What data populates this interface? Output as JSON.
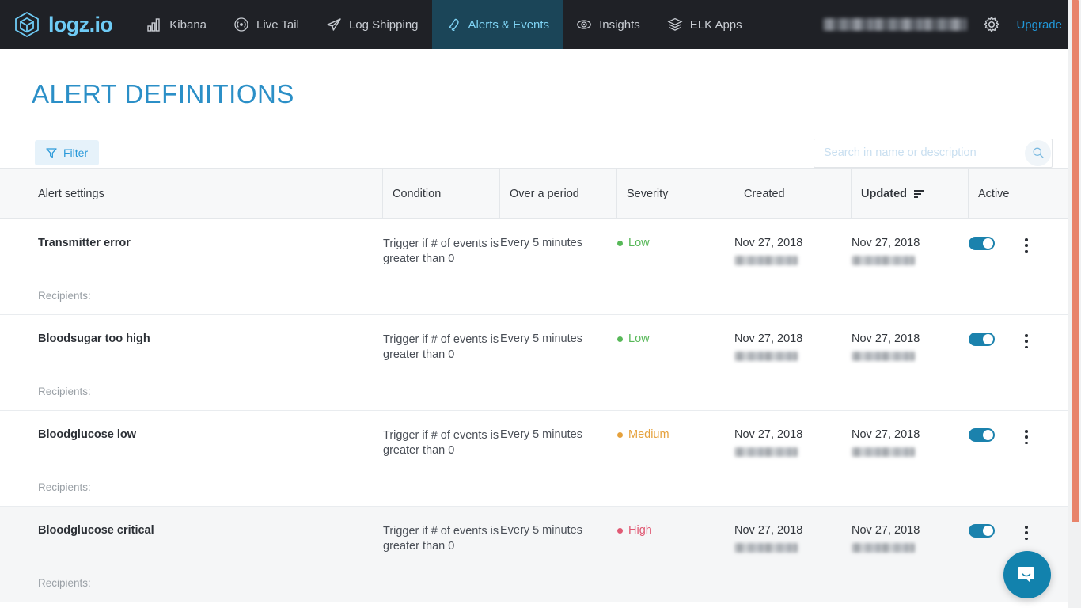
{
  "navbar": {
    "brand": "logz.io",
    "items": [
      {
        "label": "Kibana",
        "icon": "bar-chart-icon",
        "active": false
      },
      {
        "label": "Live Tail",
        "icon": "broadcast-icon",
        "active": false
      },
      {
        "label": "Log Shipping",
        "icon": "paper-plane-icon",
        "active": false
      },
      {
        "label": "Alerts & Events",
        "icon": "bell-icon",
        "active": true
      },
      {
        "label": "Insights",
        "icon": "eye-icon",
        "active": false
      },
      {
        "label": "ELK Apps",
        "icon": "layers-icon",
        "active": false
      }
    ],
    "account_redacted": "",
    "settings_icon": "gear-icon",
    "upgrade_label": "Upgrade"
  },
  "page": {
    "title": "ALERT DEFINITIONS"
  },
  "toolbar": {
    "filter_label": "Filter",
    "filter_icon": "funnel-icon",
    "search_placeholder": "Search in name or description",
    "search_value": "",
    "search_icon": "magnifier-icon"
  },
  "table": {
    "columns": [
      {
        "key": "name",
        "label": "Alert settings",
        "sorted": false
      },
      {
        "key": "cond",
        "label": "Condition",
        "sorted": false
      },
      {
        "key": "period",
        "label": "Over a period",
        "sorted": false
      },
      {
        "key": "sev",
        "label": "Severity",
        "sorted": false
      },
      {
        "key": "created",
        "label": "Created",
        "sorted": false
      },
      {
        "key": "updated",
        "label": "Updated",
        "sorted": true
      },
      {
        "key": "active",
        "label": "Active",
        "sorted": false
      }
    ],
    "sort_icon": "sort-descending-icon",
    "recipients_label": "Recipients:",
    "rows": [
      {
        "name": "Transmitter error",
        "condition": "Trigger if # of events is greater than 0",
        "period": "Every 5 minutes",
        "severity": "Low",
        "severity_color": "#57b858",
        "created": "Nov 27, 2018",
        "updated": "Nov 27, 2018",
        "active": true,
        "hovered": false
      },
      {
        "name": "Bloodsugar too high",
        "condition": "Trigger if # of events is greater than 0",
        "period": "Every 5 minutes",
        "severity": "Low",
        "severity_color": "#57b858",
        "created": "Nov 27, 2018",
        "updated": "Nov 27, 2018",
        "active": true,
        "hovered": false
      },
      {
        "name": "Bloodglucose low",
        "condition": "Trigger if # of events is greater than 0",
        "period": "Every 5 minutes",
        "severity": "Medium",
        "severity_color": "#e5a13c",
        "created": "Nov 27, 2018",
        "updated": "Nov 27, 2018",
        "active": true,
        "hovered": false
      },
      {
        "name": "Bloodglucose critical",
        "condition": "Trigger if # of events is greater than 0",
        "period": "Every 5 minutes",
        "severity": "High",
        "severity_color": "#e05a74",
        "created": "Nov 27, 2018",
        "updated": "Nov 27, 2018",
        "active": true,
        "hovered": true
      }
    ]
  },
  "chat": {
    "icon": "chat-bubble-icon"
  },
  "colors": {
    "navbar_bg": "#1f2126",
    "brand": "#6ecbf5",
    "active_tab_bg": "#1b4558",
    "accent": "#2b8fc7",
    "toggle_on": "#1b82ad",
    "scrollbar": "#e8836a",
    "chat_bg": "#1282ad"
  }
}
